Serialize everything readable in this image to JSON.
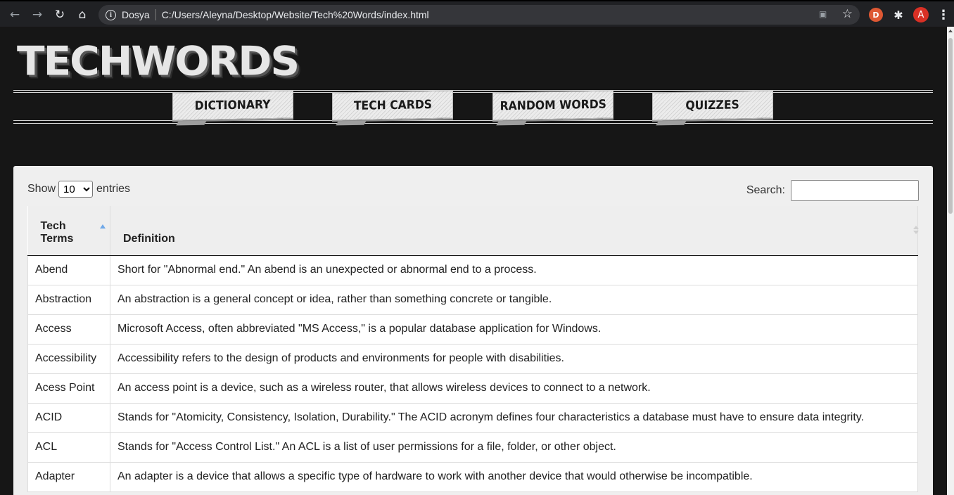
{
  "browser": {
    "back_icon": "arrow-left",
    "forward_icon": "arrow-right",
    "reload_icon": "reload",
    "home_icon": "home",
    "site_label": "Dosya",
    "url": "C:/Users/Aleyna/Desktop/Website/Tech%20Words/index.html",
    "avatar_letter": "A",
    "avatar_color": "#d93025"
  },
  "site": {
    "logo": "TECHWORDS",
    "nav": [
      "DICTIONARY",
      "TECH CARDS",
      "RANDOM WORDS",
      "QUIZZES"
    ]
  },
  "table_controls": {
    "show_label": "Show",
    "entries_selected": "10",
    "entries_label": "entries",
    "search_label": "Search:",
    "search_value": ""
  },
  "table": {
    "headers": [
      "Tech Terms",
      "Definition"
    ],
    "sort_indicator": "ascending on Tech Terms",
    "rows": [
      [
        "Abend",
        "Short for \"Abnormal end.\" An abend is an unexpected or abnormal end to a process."
      ],
      [
        "Abstraction",
        "An abstraction is a general concept or idea, rather than something concrete or tangible."
      ],
      [
        "Access",
        "Microsoft Access, often abbreviated \"MS Access,\" is a popular database application for Windows."
      ],
      [
        "Accessibility",
        "Accessibility refers to the design of products and environments for people with disabilities."
      ],
      [
        "Acess Point",
        "An access point is a device, such as a wireless router, that allows wireless devices to connect to a network."
      ],
      [
        "ACID",
        "Stands for \"Atomicity, Consistency, Isolation, Durability.\" The ACID acronym defines four characteristics a database must have to ensure data integrity."
      ],
      [
        "ACL",
        "Stands for \"Access Control List.\" An ACL is a list of user permissions for a file, folder, or other object."
      ],
      [
        "Adapter",
        "An adapter is a device that allows a specific type of hardware to work with another device that would otherwise be incompatible."
      ]
    ]
  }
}
